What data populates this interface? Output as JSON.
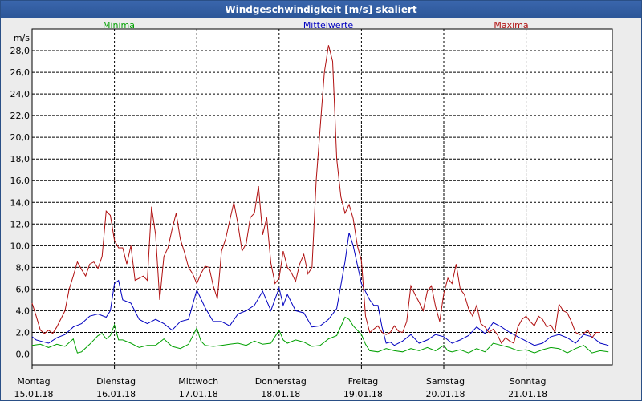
{
  "window": {
    "title": "Windgeschwindigkeit [m/s] skaliert"
  },
  "chart_data": {
    "type": "line",
    "title": "Windgeschwindigkeit [m/s] skaliert",
    "ylabel": "m/s",
    "xlabel": "",
    "ylim": [
      -1,
      30
    ],
    "yticks": [
      "0,0",
      "2,0",
      "4,0",
      "6,0",
      "8,0",
      "10,0",
      "12,0",
      "14,0",
      "16,0",
      "18,0",
      "20,0",
      "22,0",
      "24,0",
      "26,0",
      "28,0"
    ],
    "days": [
      {
        "weekday": "Montag",
        "date": "15.01.18"
      },
      {
        "weekday": "Dienstag",
        "date": "16.01.18"
      },
      {
        "weekday": "Mittwoch",
        "date": "17.01.18"
      },
      {
        "weekday": "Donnerstag",
        "date": "18.01.18"
      },
      {
        "weekday": "Freitag",
        "date": "19.01.18"
      },
      {
        "weekday": "Samstag",
        "date": "20.01.18"
      },
      {
        "weekday": "Sonntag",
        "date": "21.01.18"
      }
    ],
    "x_range_days": [
      0,
      7.2
    ],
    "grid": true,
    "legend": "top",
    "series": [
      {
        "name": "Minima",
        "color": "#00a000",
        "points": [
          [
            0,
            0.8
          ],
          [
            0.1,
            0.9
          ],
          [
            0.2,
            0.6
          ],
          [
            0.3,
            0.9
          ],
          [
            0.4,
            0.7
          ],
          [
            0.5,
            1.4
          ],
          [
            0.55,
            0.1
          ],
          [
            0.6,
            0.2
          ],
          [
            0.7,
            0.9
          ],
          [
            0.8,
            1.7
          ],
          [
            0.85,
            1.9
          ],
          [
            0.9,
            1.4
          ],
          [
            0.95,
            1.7
          ],
          [
            1.0,
            2.7
          ],
          [
            1.05,
            1.3
          ],
          [
            1.1,
            1.3
          ],
          [
            1.2,
            1.0
          ],
          [
            1.3,
            0.6
          ],
          [
            1.4,
            0.8
          ],
          [
            1.5,
            0.8
          ],
          [
            1.6,
            1.4
          ],
          [
            1.7,
            0.7
          ],
          [
            1.8,
            0.5
          ],
          [
            1.9,
            0.9
          ],
          [
            2.0,
            2.4
          ],
          [
            2.05,
            1.2
          ],
          [
            2.1,
            0.8
          ],
          [
            2.2,
            0.7
          ],
          [
            2.3,
            0.8
          ],
          [
            2.4,
            0.9
          ],
          [
            2.5,
            1.0
          ],
          [
            2.6,
            0.8
          ],
          [
            2.7,
            1.2
          ],
          [
            2.8,
            0.9
          ],
          [
            2.9,
            1.0
          ],
          [
            3.0,
            2.2
          ],
          [
            3.05,
            1.3
          ],
          [
            3.1,
            1.0
          ],
          [
            3.2,
            1.3
          ],
          [
            3.3,
            1.1
          ],
          [
            3.4,
            0.7
          ],
          [
            3.5,
            0.8
          ],
          [
            3.6,
            1.4
          ],
          [
            3.7,
            1.7
          ],
          [
            3.8,
            3.4
          ],
          [
            3.85,
            3.2
          ],
          [
            3.9,
            2.6
          ],
          [
            4.0,
            1.8
          ],
          [
            4.05,
            0.9
          ],
          [
            4.1,
            0.3
          ],
          [
            4.2,
            0.2
          ],
          [
            4.3,
            0.5
          ],
          [
            4.4,
            0.3
          ],
          [
            4.5,
            0.2
          ],
          [
            4.6,
            0.5
          ],
          [
            4.7,
            0.3
          ],
          [
            4.8,
            0.6
          ],
          [
            4.9,
            0.3
          ],
          [
            5.0,
            0.8
          ],
          [
            5.05,
            0.3
          ],
          [
            5.1,
            0.2
          ],
          [
            5.2,
            0.4
          ],
          [
            5.3,
            0.1
          ],
          [
            5.4,
            0.5
          ],
          [
            5.5,
            0.2
          ],
          [
            5.6,
            1.0
          ],
          [
            5.7,
            0.8
          ],
          [
            5.8,
            0.6
          ],
          [
            5.9,
            0.3
          ],
          [
            6.0,
            0.4
          ],
          [
            6.1,
            0.1
          ],
          [
            6.2,
            0.4
          ],
          [
            6.3,
            0.6
          ],
          [
            6.4,
            0.5
          ],
          [
            6.5,
            0.1
          ],
          [
            6.6,
            0.5
          ],
          [
            6.7,
            0.8
          ],
          [
            6.8,
            0.1
          ],
          [
            6.9,
            0.3
          ],
          [
            7.0,
            0.2
          ]
        ]
      },
      {
        "name": "Mittelwerte",
        "color": "#0000c0",
        "points": [
          [
            0,
            1.6
          ],
          [
            0.05,
            1.3
          ],
          [
            0.1,
            1.2
          ],
          [
            0.2,
            1.0
          ],
          [
            0.3,
            1.5
          ],
          [
            0.4,
            1.8
          ],
          [
            0.5,
            2.5
          ],
          [
            0.6,
            2.8
          ],
          [
            0.7,
            3.5
          ],
          [
            0.8,
            3.7
          ],
          [
            0.9,
            3.4
          ],
          [
            0.95,
            4.0
          ],
          [
            1.0,
            6.5
          ],
          [
            1.05,
            6.8
          ],
          [
            1.1,
            5.0
          ],
          [
            1.2,
            4.7
          ],
          [
            1.3,
            3.2
          ],
          [
            1.4,
            2.8
          ],
          [
            1.5,
            3.2
          ],
          [
            1.6,
            2.8
          ],
          [
            1.7,
            2.2
          ],
          [
            1.8,
            3.0
          ],
          [
            1.9,
            3.2
          ],
          [
            2.0,
            5.9
          ],
          [
            2.1,
            4.3
          ],
          [
            2.2,
            3.0
          ],
          [
            2.3,
            3.0
          ],
          [
            2.4,
            2.6
          ],
          [
            2.5,
            3.7
          ],
          [
            2.6,
            4.0
          ],
          [
            2.7,
            4.5
          ],
          [
            2.8,
            5.8
          ],
          [
            2.9,
            4.0
          ],
          [
            3.0,
            6.1
          ],
          [
            3.05,
            4.5
          ],
          [
            3.1,
            5.5
          ],
          [
            3.2,
            4.0
          ],
          [
            3.3,
            3.8
          ],
          [
            3.4,
            2.5
          ],
          [
            3.5,
            2.6
          ],
          [
            3.6,
            3.2
          ],
          [
            3.7,
            4.2
          ],
          [
            3.8,
            8.5
          ],
          [
            3.85,
            11.2
          ],
          [
            3.9,
            10.0
          ],
          [
            4.0,
            6.5
          ],
          [
            4.1,
            5.0
          ],
          [
            4.15,
            4.5
          ],
          [
            4.2,
            4.5
          ],
          [
            4.25,
            2.5
          ],
          [
            4.3,
            1.0
          ],
          [
            4.35,
            1.1
          ],
          [
            4.4,
            0.8
          ],
          [
            4.5,
            1.2
          ],
          [
            4.6,
            1.8
          ],
          [
            4.7,
            1.0
          ],
          [
            4.8,
            1.3
          ],
          [
            4.9,
            1.8
          ],
          [
            5.0,
            1.6
          ],
          [
            5.1,
            1.0
          ],
          [
            5.2,
            1.3
          ],
          [
            5.3,
            1.7
          ],
          [
            5.4,
            2.5
          ],
          [
            5.5,
            1.9
          ],
          [
            5.6,
            2.9
          ],
          [
            5.7,
            2.5
          ],
          [
            5.8,
            2.0
          ],
          [
            5.9,
            1.6
          ],
          [
            6.0,
            1.2
          ],
          [
            6.1,
            0.8
          ],
          [
            6.2,
            1.0
          ],
          [
            6.3,
            1.6
          ],
          [
            6.4,
            1.8
          ],
          [
            6.5,
            1.5
          ],
          [
            6.6,
            1.0
          ],
          [
            6.7,
            1.8
          ],
          [
            6.8,
            1.6
          ],
          [
            6.9,
            1.0
          ],
          [
            7.0,
            0.8
          ]
        ]
      },
      {
        "name": "Maxima",
        "color": "#b01010",
        "points": [
          [
            0,
            4.7
          ],
          [
            0.05,
            3.5
          ],
          [
            0.1,
            2.2
          ],
          [
            0.15,
            1.9
          ],
          [
            0.2,
            2.2
          ],
          [
            0.25,
            1.9
          ],
          [
            0.3,
            2.5
          ],
          [
            0.4,
            4.0
          ],
          [
            0.45,
            6.0
          ],
          [
            0.5,
            7.2
          ],
          [
            0.55,
            8.5
          ],
          [
            0.6,
            7.8
          ],
          [
            0.65,
            7.2
          ],
          [
            0.7,
            8.3
          ],
          [
            0.75,
            8.5
          ],
          [
            0.8,
            7.9
          ],
          [
            0.85,
            9.0
          ],
          [
            0.9,
            13.2
          ],
          [
            0.95,
            12.8
          ],
          [
            1.0,
            10.5
          ],
          [
            1.05,
            9.8
          ],
          [
            1.1,
            9.8
          ],
          [
            1.15,
            8.3
          ],
          [
            1.2,
            10.0
          ],
          [
            1.25,
            6.8
          ],
          [
            1.3,
            7.0
          ],
          [
            1.35,
            7.2
          ],
          [
            1.4,
            6.8
          ],
          [
            1.45,
            13.6
          ],
          [
            1.5,
            11.0
          ],
          [
            1.55,
            5.0
          ],
          [
            1.6,
            9.0
          ],
          [
            1.65,
            9.8
          ],
          [
            1.7,
            11.5
          ],
          [
            1.75,
            13.0
          ],
          [
            1.8,
            10.6
          ],
          [
            1.85,
            9.4
          ],
          [
            1.9,
            8.0
          ],
          [
            1.95,
            7.4
          ],
          [
            2.0,
            6.5
          ],
          [
            2.05,
            7.4
          ],
          [
            2.1,
            8.1
          ],
          [
            2.15,
            8.0
          ],
          [
            2.2,
            6.3
          ],
          [
            2.25,
            5.1
          ],
          [
            2.3,
            9.5
          ],
          [
            2.35,
            10.6
          ],
          [
            2.4,
            12.3
          ],
          [
            2.45,
            14.0
          ],
          [
            2.5,
            12.0
          ],
          [
            2.55,
            9.5
          ],
          [
            2.6,
            10.2
          ],
          [
            2.65,
            12.6
          ],
          [
            2.7,
            13.0
          ],
          [
            2.75,
            15.5
          ],
          [
            2.8,
            11.0
          ],
          [
            2.85,
            12.6
          ],
          [
            2.9,
            8.4
          ],
          [
            2.95,
            6.5
          ],
          [
            3.0,
            7.0
          ],
          [
            3.05,
            9.5
          ],
          [
            3.1,
            8.0
          ],
          [
            3.15,
            7.5
          ],
          [
            3.2,
            6.7
          ],
          [
            3.25,
            8.3
          ],
          [
            3.3,
            9.2
          ],
          [
            3.35,
            7.4
          ],
          [
            3.4,
            8.0
          ],
          [
            3.45,
            16.0
          ],
          [
            3.5,
            21.0
          ],
          [
            3.55,
            26.0
          ],
          [
            3.6,
            28.5
          ],
          [
            3.65,
            27.0
          ],
          [
            3.7,
            18.0
          ],
          [
            3.75,
            14.5
          ],
          [
            3.8,
            13.0
          ],
          [
            3.85,
            13.8
          ],
          [
            3.9,
            12.5
          ],
          [
            3.95,
            10.0
          ],
          [
            4.0,
            8.6
          ],
          [
            4.05,
            3.5
          ],
          [
            4.1,
            2.0
          ],
          [
            4.15,
            2.3
          ],
          [
            4.2,
            2.6
          ],
          [
            4.25,
            2.0
          ],
          [
            4.3,
            1.8
          ],
          [
            4.35,
            2.0
          ],
          [
            4.4,
            2.6
          ],
          [
            4.45,
            2.1
          ],
          [
            4.5,
            2.0
          ],
          [
            4.55,
            3.0
          ],
          [
            4.6,
            6.3
          ],
          [
            4.65,
            5.5
          ],
          [
            4.7,
            4.8
          ],
          [
            4.75,
            4.0
          ],
          [
            4.8,
            5.8
          ],
          [
            4.85,
            6.3
          ],
          [
            4.9,
            4.4
          ],
          [
            4.95,
            3.0
          ],
          [
            5.0,
            5.6
          ],
          [
            5.05,
            7.0
          ],
          [
            5.1,
            6.5
          ],
          [
            5.15,
            8.3
          ],
          [
            5.2,
            6.0
          ],
          [
            5.25,
            5.5
          ],
          [
            5.3,
            4.2
          ],
          [
            5.35,
            3.5
          ],
          [
            5.4,
            4.5
          ],
          [
            5.45,
            2.8
          ],
          [
            5.5,
            2.5
          ],
          [
            5.55,
            2.0
          ],
          [
            5.6,
            2.3
          ],
          [
            5.65,
            1.8
          ],
          [
            5.7,
            1.0
          ],
          [
            5.75,
            1.5
          ],
          [
            5.8,
            1.2
          ],
          [
            5.85,
            1.0
          ],
          [
            5.9,
            2.5
          ],
          [
            5.95,
            3.2
          ],
          [
            6.0,
            3.5
          ],
          [
            6.05,
            3.0
          ],
          [
            6.1,
            2.6
          ],
          [
            6.15,
            3.5
          ],
          [
            6.2,
            3.2
          ],
          [
            6.25,
            2.5
          ],
          [
            6.3,
            2.7
          ],
          [
            6.35,
            2.0
          ],
          [
            6.4,
            4.6
          ],
          [
            6.45,
            4.0
          ],
          [
            6.5,
            3.8
          ],
          [
            6.55,
            3.0
          ],
          [
            6.6,
            2.0
          ],
          [
            6.65,
            1.8
          ],
          [
            6.7,
            1.9
          ],
          [
            6.75,
            2.2
          ],
          [
            6.8,
            1.5
          ],
          [
            6.85,
            2.0
          ],
          [
            6.9,
            2.0
          ]
        ]
      }
    ]
  }
}
